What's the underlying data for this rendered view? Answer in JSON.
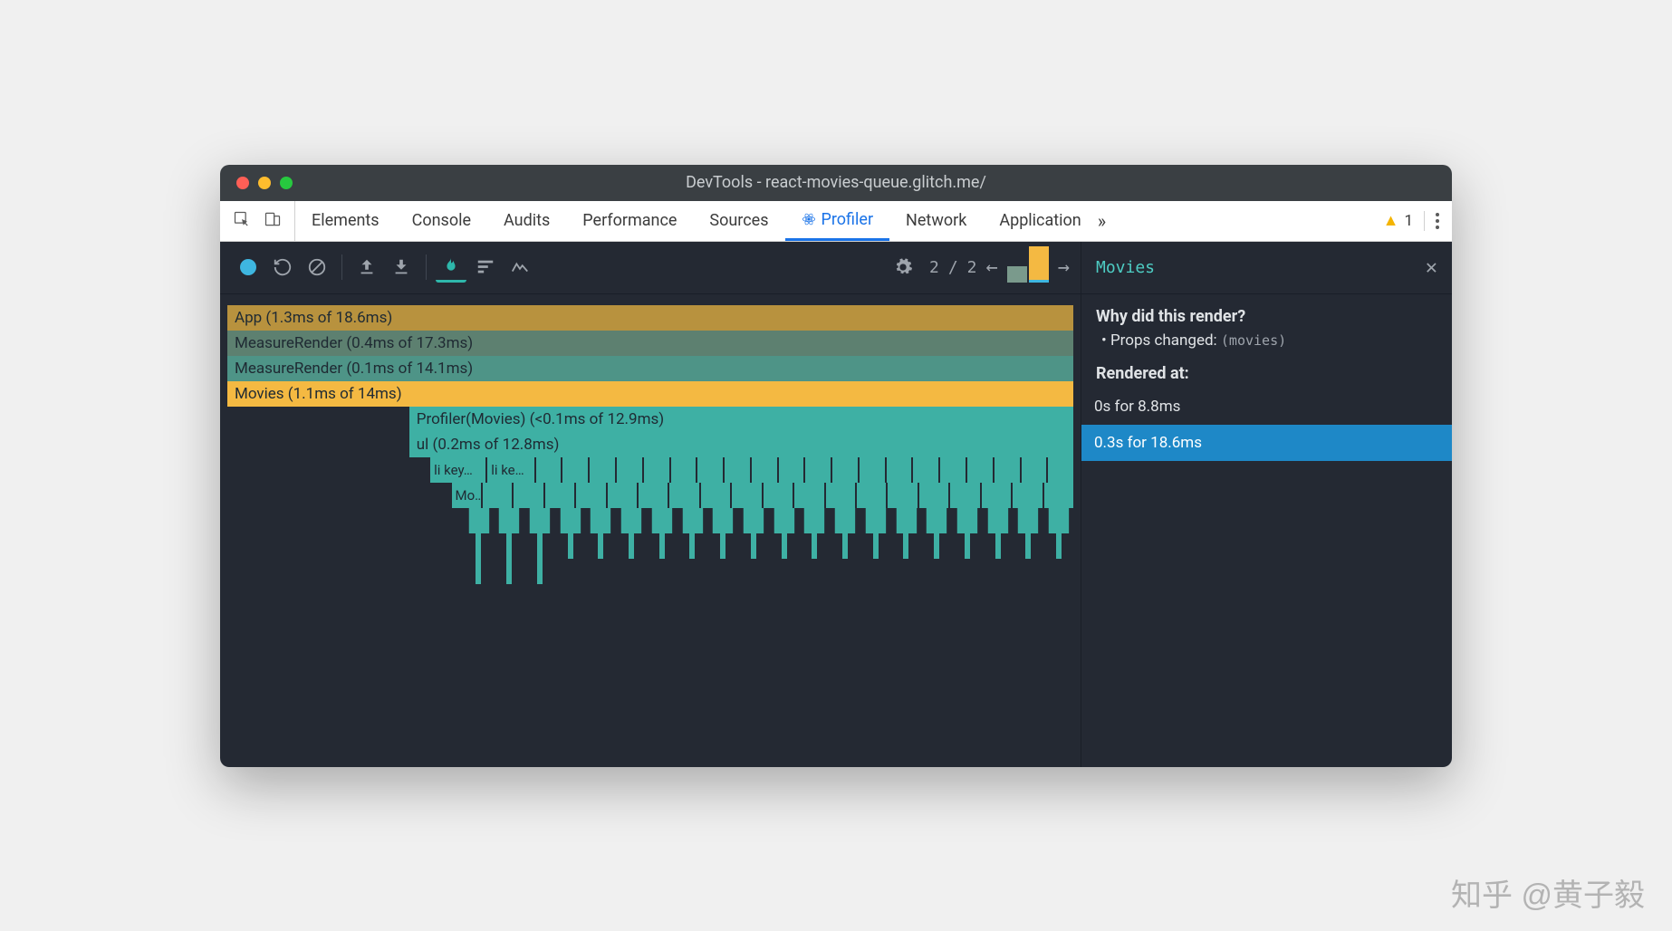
{
  "window": {
    "title": "DevTools - react-movies-queue.glitch.me/"
  },
  "tabs": {
    "items": [
      "Elements",
      "Console",
      "Audits",
      "Performance",
      "Sources",
      "Profiler",
      "Network",
      "Application"
    ],
    "active": "Profiler",
    "warnings": "1"
  },
  "profiler_toolbar": {
    "commit_index": "2",
    "commit_sep": "/",
    "commit_total": "2"
  },
  "flame": {
    "rows": [
      "App (1.3ms of 18.6ms)",
      "MeasureRender (0.4ms of 17.3ms)",
      "MeasureRender (0.1ms of 14.1ms)",
      "Movies (1.1ms of 14ms)",
      "Profiler(Movies) (<0.1ms of 12.9ms)",
      "ul (0.2ms of 12.8ms)"
    ],
    "li1": "li key…",
    "li2": "li ke…",
    "mo": "Mo…"
  },
  "sidebar": {
    "component": "Movies",
    "why_title": "Why did this render?",
    "why_reason": "Props changed:",
    "why_props": "(movies)",
    "rendered_title": "Rendered at:",
    "renders": [
      "0s for 8.8ms",
      "0.3s for 18.6ms"
    ]
  },
  "watermark": "知乎 @黄子毅"
}
